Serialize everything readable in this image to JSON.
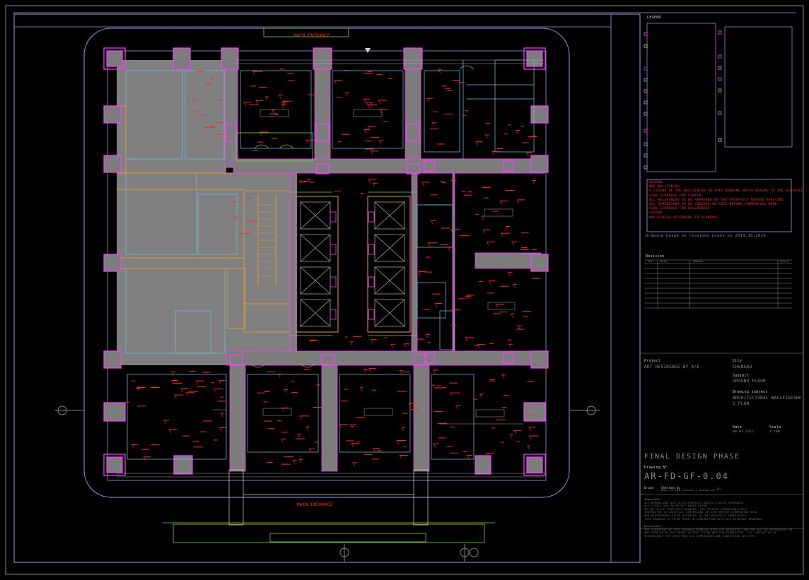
{
  "legend": {
    "title": "LEGEND"
  },
  "legend_note": {
    "lines": [
      "LEGEND:",
      "AWE WALLFINISH",
      "A LEGEND OF THE WALLFINISH IN THIS DRAWING WHICH REFERS TO THE SCHEDULE",
      "LOOK SCHEDULE FOR FINISH",
      "ALL WALLFINISH TO BE APPROVED BY THE ARCHITECT BEFORE APPLYING",
      "ALL DIMENSIONS TO BE CHECKED ON SITE BEFORE COMMENCING WORK",
      "LOOK SCHEDULE FOR WALLFINISH",
      "LEGEND:",
      "WALLFINISH ACCORDING TO SCHEDULE"
    ]
  },
  "based_on": "Drawing based on received plans on 2014.10.2014",
  "revision": {
    "title": "Revision",
    "cols": [
      "Ver",
      "Date",
      "Remark",
      "Check"
    ]
  },
  "title_block": {
    "project_label": "Project",
    "project_value": "ART RESIDENCE BY A/E",
    "city_label": "City",
    "city_value": "CHENGDU",
    "subject_label": "Subject",
    "subject_value": "GROUND FLOOR",
    "drawing_label": "Drawing subject",
    "drawing_value_1": "ARCHITECTURAL WALLFINISHE",
    "drawing_value_2": "S PLAN",
    "date_label": "Date",
    "date_value": "09.03.2015",
    "scale_label": "Scale",
    "scale_value": "1:100",
    "phase": "FINAL DESIGN PHASE",
    "drawing_no_label": "Drawing N°",
    "drawing_no": "AR-FD-GF-0.04",
    "drawn_label": "Drawn",
    "checked_label": "Checked by",
    "checked_value": "Name of the checker / signature",
    "sheet": "A1"
  },
  "plan": {
    "top_entrance": "MAIN ENTRANCE",
    "bottom_entrance": "MAIN ENTRANCE"
  },
  "notes": {
    "title": "Important:",
    "lines": [
      "ALL DIMENSIONS ARE IN MILLIMETRES UNLESS STATED OTHERWISE",
      "ALL LEVELS ARE IN METRES ABOVE DATUM",
      "DO NOT SCALE FROM THIS DRAWING, USE FIGURED DIMENSIONS ONLY",
      "CONTRACTOR TO CHECK ALL DIMENSIONS ON SITE BEFORE COMMENCING WORK",
      "ANY DISCREPANCY TO BE REPORTED TO THE ARCHITECT IMMEDIATELY",
      "THIS DRAWING IS TO BE READ IN CONJUNCTION WITH ALL RELEVANT DRAWINGS"
    ],
    "disclaimer_title": "Disclaimer:",
    "disclaimer": "THE COPYRIGHT OF THIS DRAWING REMAINS WITH THE ARCHITECT AND MAY NOT BE REPRODUCED IN ANY FORM OR BY ANY MEANS WITHOUT PRIOR WRITTEN PERMISSION. THE CONTRACTOR IS RESPONSIBLE FOR VERIFYING ALL DIMENSIONS AND CONDITIONS ON SITE."
  },
  "colors": {
    "background": "#000000",
    "frame": "#9a9ae8",
    "column": "#ff3cff",
    "annotation": "#ff2a2a",
    "gray_zone": "#808080",
    "orange": "#e89a30",
    "cyan": "#6cc6e6",
    "green": "#7ad24a"
  }
}
